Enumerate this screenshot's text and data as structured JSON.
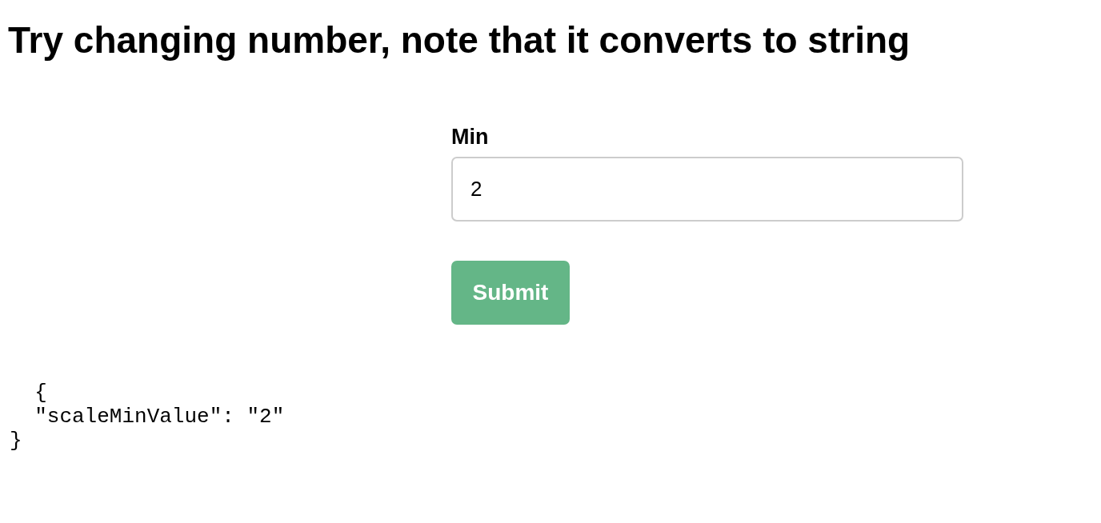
{
  "heading": "Try changing number, note that it converts to string",
  "form": {
    "fields": [
      {
        "label": "Min",
        "value": "2"
      }
    ],
    "submit": "Submit"
  },
  "output": "  {\n  \"scaleMinValue\": \"2\"\n}"
}
